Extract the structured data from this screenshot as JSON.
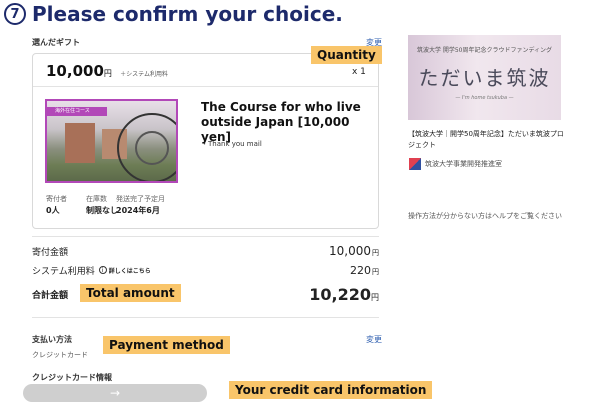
{
  "header": {
    "step_number": "7",
    "title": "Please confirm your choice."
  },
  "selected_gift": {
    "section_label": "選んだギフト",
    "change_link": "変更",
    "price": "10,000",
    "yen": "円",
    "fee_note": "＋システム利用料",
    "quantity": "x 1",
    "image_ribbon": "海外在住コース",
    "course_title": "The Course for who live outside Japan [10,000 yen]",
    "bullet": "・Thank you mail",
    "stats": [
      {
        "label": "寄付者",
        "value": "0人"
      },
      {
        "label": "在庫数",
        "value": "制限なし"
      },
      {
        "label": "発送完了予定月",
        "value": "2024年6月"
      }
    ]
  },
  "summary": {
    "donation_label": "寄付金額",
    "donation_value": "10,000",
    "fee_label": "システム利用料",
    "fee_info_icon": "info-icon",
    "fee_details_link": "詳しくはこちら",
    "fee_value": "220",
    "total_label": "合計金額",
    "total_value": "10,220",
    "yen": "円"
  },
  "payment": {
    "label": "支払い方法",
    "change_link": "変更",
    "method": "クレジットカード",
    "card_info_label": "クレジットカード情報",
    "card_button_arrow": "→"
  },
  "annotations": {
    "quantity": "Quantity",
    "total_amount": "Total amount",
    "payment_method": "Payment method",
    "credit_card": "Your credit card information"
  },
  "project": {
    "image_subtitle": "筑波大学 開学50周年記念クラウドファンディング",
    "image_title": "ただいま筑波",
    "image_english": "— I'm home tsukuba —",
    "title": "【筑波大学｜開学50周年記念】ただいま筑波プロジェクト",
    "org_icon": "university-logo-icon",
    "org_name": "筑波大学事業開発推進室",
    "help_text": "操作方法が分からない方はヘルプをご覧ください"
  },
  "colors": {
    "heading": "#1d2a6b",
    "highlight": "#f9c56a",
    "link": "#3060b0",
    "image_border": "#b248b8"
  }
}
